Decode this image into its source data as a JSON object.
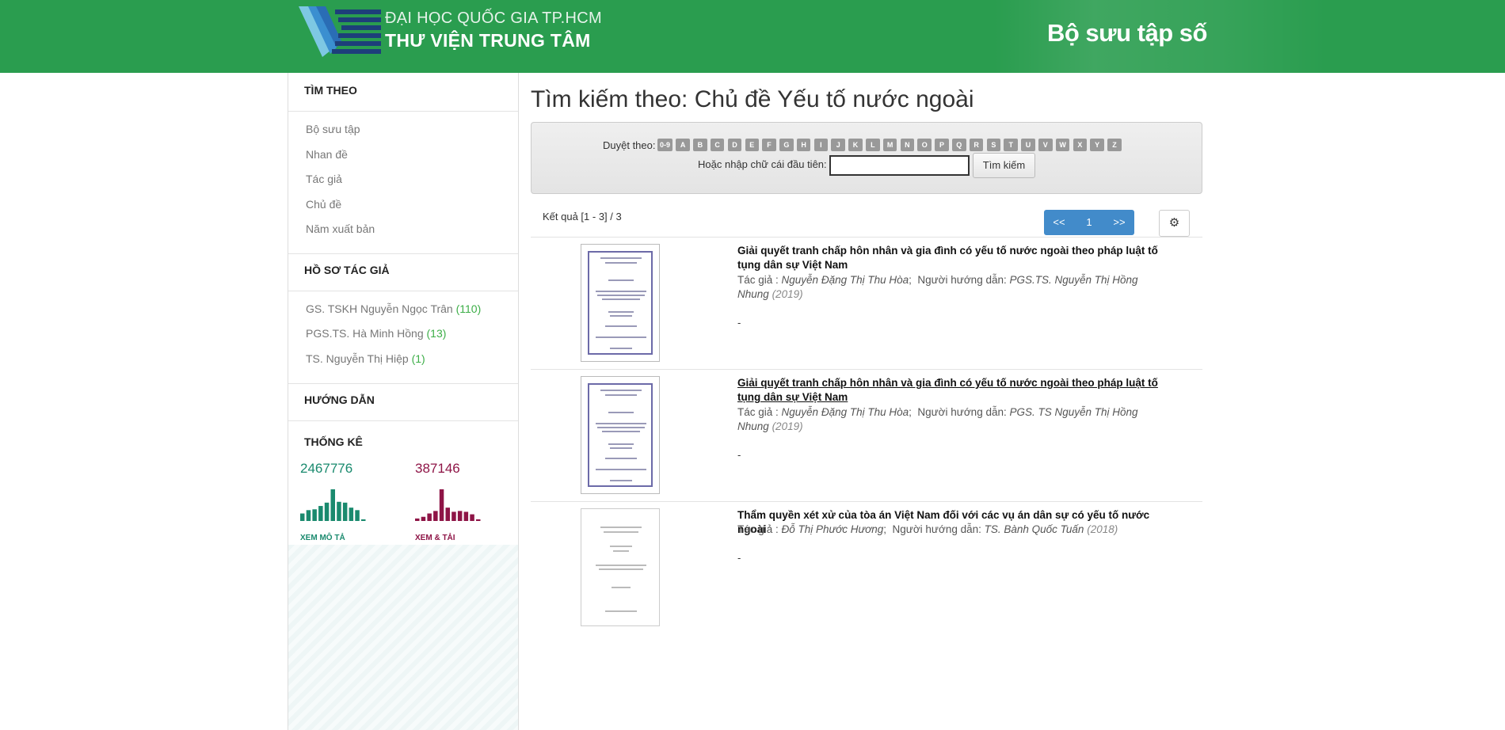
{
  "header": {
    "university": "ĐẠI HỌC QUỐC GIA TP.HCM",
    "library": "THƯ VIỆN TRUNG TÂM",
    "site_title": "Bộ sưu tập số"
  },
  "sidebar": {
    "search_by": {
      "heading": "TÌM THEO",
      "items": [
        "Bộ sưu tập",
        "Nhan đề",
        "Tác giả",
        "Chủ đề",
        "Năm xuất bản"
      ]
    },
    "author_profiles": {
      "heading": "HỒ SƠ TÁC GIẢ",
      "items": [
        {
          "name": "GS. TSKH Nguyễn Ngọc Trân",
          "count": "(110)"
        },
        {
          "name": "PGS.TS. Hà Minh Hồng",
          "count": "(13)"
        },
        {
          "name": "TS. Nguyễn Thị Hiệp",
          "count": "(1)"
        }
      ]
    },
    "guide": {
      "heading": "HƯỚNG DẪN"
    },
    "stats": {
      "heading": "THỐNG KÊ",
      "views": {
        "value": "2467776",
        "link": "XEM MÔ TẢ",
        "color": "#1a8a6e",
        "bars": [
          9,
          13,
          14,
          18,
          22,
          38,
          23,
          22,
          16,
          13,
          2
        ]
      },
      "downloads": {
        "value": "387146",
        "link": "XEM & TẢI",
        "color": "#8e1446",
        "bars": [
          3,
          5,
          9,
          12,
          38,
          16,
          11,
          12,
          11,
          8,
          2
        ]
      }
    }
  },
  "main": {
    "title": "Tìm kiếm theo: Chủ đề Yếu tố nước ngoài",
    "browse": {
      "label": "Duyệt theo:",
      "letters": [
        "0-9",
        "A",
        "B",
        "C",
        "D",
        "E",
        "F",
        "G",
        "H",
        "I",
        "J",
        "K",
        "L",
        "M",
        "N",
        "O",
        "P",
        "Q",
        "R",
        "S",
        "T",
        "U",
        "V",
        "W",
        "X",
        "Y",
        "Z"
      ],
      "enter_label": "Hoặc nhập chữ cái đầu tiên:",
      "input_value": "",
      "button": "Tìm kiếm"
    },
    "results_summary": "Kết quả [1 - 3] / 3",
    "pager": {
      "prev": "<<",
      "page": "1",
      "next": ">>"
    },
    "settings_icon": "gear-icon",
    "results": [
      {
        "title": "Giải quyết tranh chấp hôn nhân và gia đình có yếu tố nước ngoài theo pháp luật tố tụng dân sự Việt Nam",
        "author_label": "Tác giả : ",
        "author": "Nguyễn Đặng Thị Thu Hòa",
        "advisor_label": "Người hướng dẫn: ",
        "advisor": "PGS.TS. Nguyễn Thị Hồng Nhung",
        "year": "(2019)",
        "extra": "-"
      },
      {
        "title": "Giải quyết tranh chấp hôn nhân và gia đình có yếu tố nước ngoài theo pháp luật tố tụng dân sự Việt Nam",
        "author_label": "Tác giả : ",
        "author": "Nguyễn Đặng Thị Thu Hòa",
        "advisor_label": "Người hướng dẫn: ",
        "advisor": "PGS. TS Nguyễn Thị Hồng Nhung",
        "year": "(2019)",
        "extra": "-"
      },
      {
        "title": "Thẩm quyền xét xử của tòa án Việt Nam đối với các vụ án dân sự có yếu tố nước ngoài",
        "author_label": "Tác giả : ",
        "author": "Đỗ Thị Phước Hương",
        "advisor_label": "Người hướng dẫn: ",
        "advisor": "TS. Bành Quốc Tuấn",
        "year": "(2018)",
        "extra": "-"
      }
    ]
  }
}
